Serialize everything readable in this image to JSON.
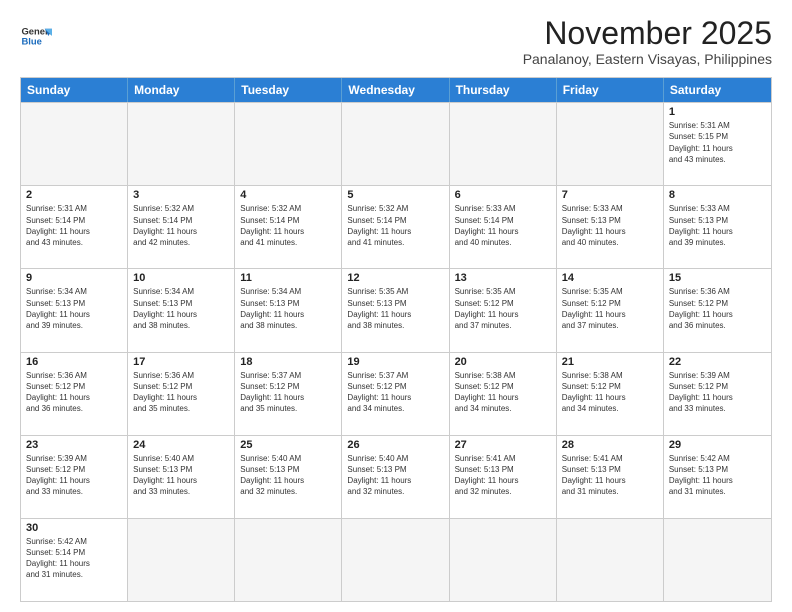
{
  "logo": {
    "line1": "General",
    "line2": "Blue"
  },
  "title": "November 2025",
  "subtitle": "Panalanoy, Eastern Visayas, Philippines",
  "header_days": [
    "Sunday",
    "Monday",
    "Tuesday",
    "Wednesday",
    "Thursday",
    "Friday",
    "Saturday"
  ],
  "weeks": [
    [
      {
        "day": "",
        "info": ""
      },
      {
        "day": "",
        "info": ""
      },
      {
        "day": "",
        "info": ""
      },
      {
        "day": "",
        "info": ""
      },
      {
        "day": "",
        "info": ""
      },
      {
        "day": "",
        "info": ""
      },
      {
        "day": "1",
        "info": "Sunrise: 5:31 AM\nSunset: 5:15 PM\nDaylight: 11 hours\nand 43 minutes."
      }
    ],
    [
      {
        "day": "2",
        "info": "Sunrise: 5:31 AM\nSunset: 5:14 PM\nDaylight: 11 hours\nand 43 minutes."
      },
      {
        "day": "3",
        "info": "Sunrise: 5:32 AM\nSunset: 5:14 PM\nDaylight: 11 hours\nand 42 minutes."
      },
      {
        "day": "4",
        "info": "Sunrise: 5:32 AM\nSunset: 5:14 PM\nDaylight: 11 hours\nand 41 minutes."
      },
      {
        "day": "5",
        "info": "Sunrise: 5:32 AM\nSunset: 5:14 PM\nDaylight: 11 hours\nand 41 minutes."
      },
      {
        "day": "6",
        "info": "Sunrise: 5:33 AM\nSunset: 5:14 PM\nDaylight: 11 hours\nand 40 minutes."
      },
      {
        "day": "7",
        "info": "Sunrise: 5:33 AM\nSunset: 5:13 PM\nDaylight: 11 hours\nand 40 minutes."
      },
      {
        "day": "8",
        "info": "Sunrise: 5:33 AM\nSunset: 5:13 PM\nDaylight: 11 hours\nand 39 minutes."
      }
    ],
    [
      {
        "day": "9",
        "info": "Sunrise: 5:34 AM\nSunset: 5:13 PM\nDaylight: 11 hours\nand 39 minutes."
      },
      {
        "day": "10",
        "info": "Sunrise: 5:34 AM\nSunset: 5:13 PM\nDaylight: 11 hours\nand 38 minutes."
      },
      {
        "day": "11",
        "info": "Sunrise: 5:34 AM\nSunset: 5:13 PM\nDaylight: 11 hours\nand 38 minutes."
      },
      {
        "day": "12",
        "info": "Sunrise: 5:35 AM\nSunset: 5:13 PM\nDaylight: 11 hours\nand 38 minutes."
      },
      {
        "day": "13",
        "info": "Sunrise: 5:35 AM\nSunset: 5:12 PM\nDaylight: 11 hours\nand 37 minutes."
      },
      {
        "day": "14",
        "info": "Sunrise: 5:35 AM\nSunset: 5:12 PM\nDaylight: 11 hours\nand 37 minutes."
      },
      {
        "day": "15",
        "info": "Sunrise: 5:36 AM\nSunset: 5:12 PM\nDaylight: 11 hours\nand 36 minutes."
      }
    ],
    [
      {
        "day": "16",
        "info": "Sunrise: 5:36 AM\nSunset: 5:12 PM\nDaylight: 11 hours\nand 36 minutes."
      },
      {
        "day": "17",
        "info": "Sunrise: 5:36 AM\nSunset: 5:12 PM\nDaylight: 11 hours\nand 35 minutes."
      },
      {
        "day": "18",
        "info": "Sunrise: 5:37 AM\nSunset: 5:12 PM\nDaylight: 11 hours\nand 35 minutes."
      },
      {
        "day": "19",
        "info": "Sunrise: 5:37 AM\nSunset: 5:12 PM\nDaylight: 11 hours\nand 34 minutes."
      },
      {
        "day": "20",
        "info": "Sunrise: 5:38 AM\nSunset: 5:12 PM\nDaylight: 11 hours\nand 34 minutes."
      },
      {
        "day": "21",
        "info": "Sunrise: 5:38 AM\nSunset: 5:12 PM\nDaylight: 11 hours\nand 34 minutes."
      },
      {
        "day": "22",
        "info": "Sunrise: 5:39 AM\nSunset: 5:12 PM\nDaylight: 11 hours\nand 33 minutes."
      }
    ],
    [
      {
        "day": "23",
        "info": "Sunrise: 5:39 AM\nSunset: 5:12 PM\nDaylight: 11 hours\nand 33 minutes."
      },
      {
        "day": "24",
        "info": "Sunrise: 5:40 AM\nSunset: 5:13 PM\nDaylight: 11 hours\nand 33 minutes."
      },
      {
        "day": "25",
        "info": "Sunrise: 5:40 AM\nSunset: 5:13 PM\nDaylight: 11 hours\nand 32 minutes."
      },
      {
        "day": "26",
        "info": "Sunrise: 5:40 AM\nSunset: 5:13 PM\nDaylight: 11 hours\nand 32 minutes."
      },
      {
        "day": "27",
        "info": "Sunrise: 5:41 AM\nSunset: 5:13 PM\nDaylight: 11 hours\nand 32 minutes."
      },
      {
        "day": "28",
        "info": "Sunrise: 5:41 AM\nSunset: 5:13 PM\nDaylight: 11 hours\nand 31 minutes."
      },
      {
        "day": "29",
        "info": "Sunrise: 5:42 AM\nSunset: 5:13 PM\nDaylight: 11 hours\nand 31 minutes."
      }
    ],
    [
      {
        "day": "30",
        "info": "Sunrise: 5:42 AM\nSunset: 5:14 PM\nDaylight: 11 hours\nand 31 minutes."
      },
      {
        "day": "",
        "info": ""
      },
      {
        "day": "",
        "info": ""
      },
      {
        "day": "",
        "info": ""
      },
      {
        "day": "",
        "info": ""
      },
      {
        "day": "",
        "info": ""
      },
      {
        "day": "",
        "info": ""
      }
    ]
  ]
}
